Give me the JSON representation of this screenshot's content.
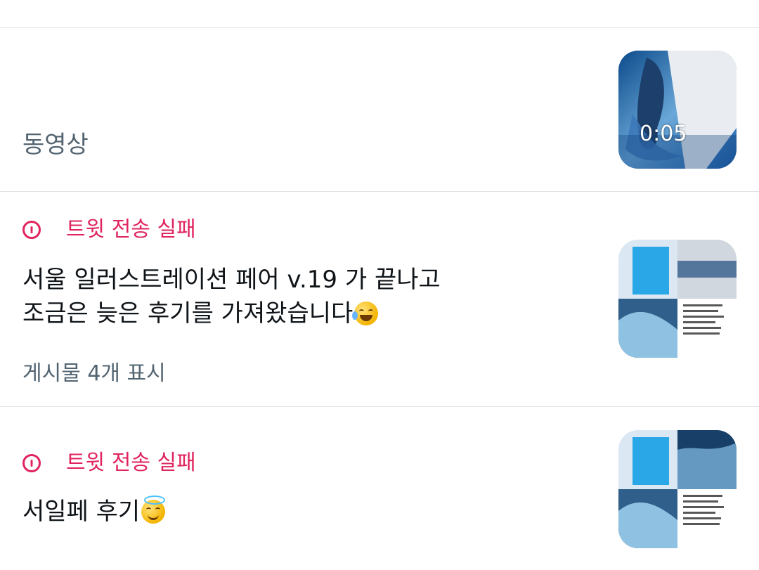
{
  "top_partial_text": "",
  "video_row": {
    "label": "동영상",
    "duration": "0:05",
    "thumbnail_icon": "illustration-whale-thumbnail"
  },
  "failed_posts": [
    {
      "status": "트윗 전송 실패",
      "line1": "서울 일러스트레이션 페어 v.19 가 끝나고",
      "line2": "조금은 늦은 후기를 가져왔습니다",
      "emoji": "face-with-tears-of-joy",
      "show_more": "게시물 4개 표시"
    },
    {
      "status": "트윗 전송 실패",
      "line1": "서일페 후기",
      "emoji": "smiling-face-with-halo"
    }
  ],
  "colors": {
    "error": "#e0245e",
    "secondary_text": "#536471",
    "divider": "#dfe3e6"
  }
}
